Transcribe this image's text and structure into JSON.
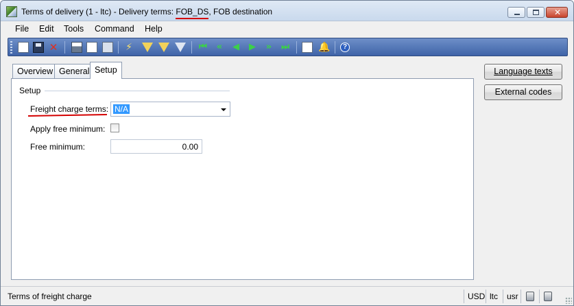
{
  "window": {
    "title_prefix": "Terms of delivery (1 - ltc) - Delivery terms: ",
    "title_key": "FOB_DS",
    "title_suffix": ", FOB destination"
  },
  "menu": [
    "File",
    "Edit",
    "Tools",
    "Command",
    "Help"
  ],
  "toolbar": {
    "icons": [
      "new-record-icon",
      "save-icon",
      "delete-icon",
      "print-icon",
      "print-preview-icon",
      "export-icon",
      "filter-by-selection-icon",
      "filter-by-grid-icon",
      "advanced-filter-icon",
      "clear-filter-icon",
      "first-record-icon",
      "previous-page-icon",
      "previous-record-icon",
      "next-record-icon",
      "next-page-icon",
      "last-record-icon",
      "document-handling-icon",
      "alert-icon",
      "help-icon"
    ]
  },
  "tabs": [
    "Overview",
    "General",
    "Setup"
  ],
  "active_tab": "Setup",
  "setup": {
    "group_title": "Setup",
    "freight_label": "Freight charge terms:",
    "freight_value": "N/A",
    "apply_free_min_label": "Apply free minimum:",
    "apply_free_min_checked": false,
    "free_min_label": "Free minimum:",
    "free_min_value": "0.00"
  },
  "side_buttons": {
    "language_texts": "Language texts",
    "external_codes": "External codes"
  },
  "status": {
    "message": "Terms of freight charge",
    "currency": "USD",
    "company": "ltc",
    "user": "usr"
  }
}
